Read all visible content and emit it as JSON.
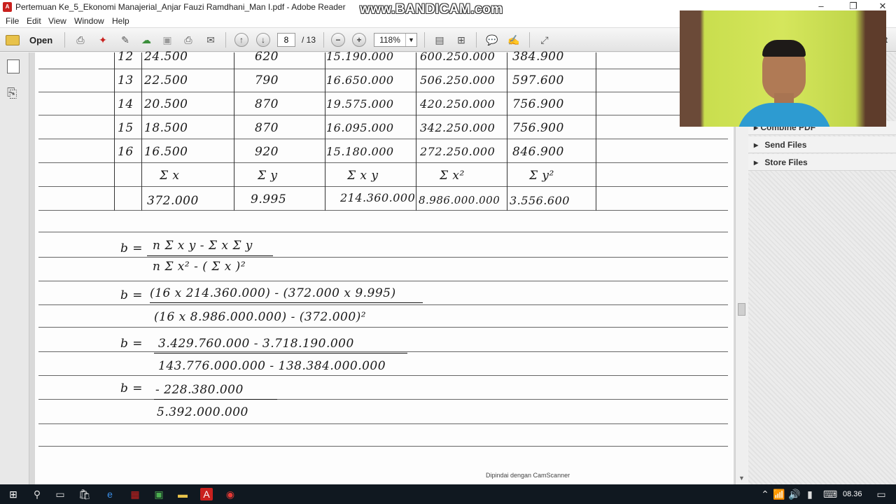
{
  "window": {
    "title": "Pertemuan Ke_5_Ekonomi Manajerial_Anjar Fauzi Ramdhani_Man I.pdf - Adobe Reader",
    "watermark": "www.BANDICAM.com"
  },
  "menu": [
    "File",
    "Edit",
    "View",
    "Window",
    "Help"
  ],
  "toolbar": {
    "open_label": "Open",
    "page_current": "8",
    "page_total": "/ 13",
    "zoom": "118%"
  },
  "right_panel": {
    "partial_label": "t",
    "items": [
      "Combine PDF",
      "Send Files",
      "Store Files"
    ]
  },
  "table": {
    "rows": [
      {
        "n": "12",
        "x": "24.500",
        "y": "620",
        "xy": "15.190.000",
        "x2": "600.250.000",
        "y2": "384.900"
      },
      {
        "n": "13",
        "x": "22.500",
        "y": "790",
        "xy": "16.650.000",
        "x2": "506.250.000",
        "y2": "597.600"
      },
      {
        "n": "14",
        "x": "20.500",
        "y": "870",
        "xy": "19.575.000",
        "x2": "420.250.000",
        "y2": "756.900"
      },
      {
        "n": "15",
        "x": "18.500",
        "y": "870",
        "xy": "16.095.000",
        "x2": "342.250.000",
        "y2": "756.900"
      },
      {
        "n": "16",
        "x": "16.500",
        "y": "920",
        "xy": "15.180.000",
        "x2": "272.250.000",
        "y2": "846.900"
      }
    ],
    "sum_headers": [
      "Σ x",
      "Σ y",
      "Σ x y",
      "Σ x²",
      "Σ y²"
    ],
    "sums": [
      "372.000",
      "9.995",
      "214.360.000",
      "8.986.000.000",
      "3.556.600"
    ]
  },
  "equations": {
    "l1_lhs": "b =",
    "l1_num": "n Σ x y - Σ x Σ y",
    "l1_den": "n Σ x² - ( Σ x )²",
    "l2_lhs": "b =",
    "l2_num": "(16 x 214.360.000) - (372.000 x 9.995)",
    "l2_den": "(16 x 8.986.000.000) - (372.000)²",
    "l3_lhs": "b =",
    "l3_num": "3.429.760.000 - 3.718.190.000",
    "l3_den": "143.776.000.000 - 138.384.000.000",
    "l4_lhs": "b =",
    "l4_num": "- 228.380.000",
    "l4_den": "5.392.000.000"
  },
  "footer_note": "Dipindai dengan CamScanner",
  "taskbar": {
    "time": "08.36"
  }
}
